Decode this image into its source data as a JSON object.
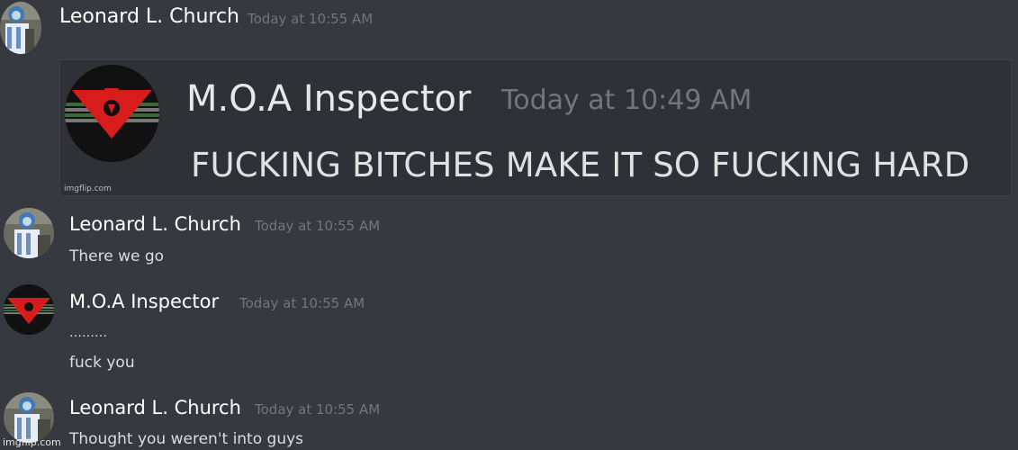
{
  "messages": [
    {
      "author": "Leonard L. Church",
      "time": "Today at 10:55 AM"
    },
    {
      "author": "Leonard L. Church",
      "time": "Today at 10:55 AM",
      "lines": [
        "There we go"
      ]
    },
    {
      "author": "M.O.A Inspector",
      "time": "Today at 10:55 AM",
      "lines": [
        "………",
        "fuck you"
      ]
    },
    {
      "author": "Leonard L. Church",
      "time": "Today at 10:55 AM",
      "lines": [
        "Thought you weren't into guys"
      ]
    }
  ],
  "embed": {
    "author": "M.O.A Inspector",
    "time": "Today at 10:49 AM",
    "text": "FUCKING BITCHES MAKE IT SO FUCKING HARD",
    "watermark": "imgflip.com"
  },
  "watermark": "imgflip.com",
  "icons": {
    "leonard_avatar": "person-avatar-icon",
    "inspector_avatar": "arstotzka-eagle-emblem-icon"
  },
  "colors": {
    "background": "#36393f",
    "username": "#ffffff",
    "timestamp": "#72767d",
    "text": "#dcddde",
    "emblem_red": "#d71c1c"
  }
}
